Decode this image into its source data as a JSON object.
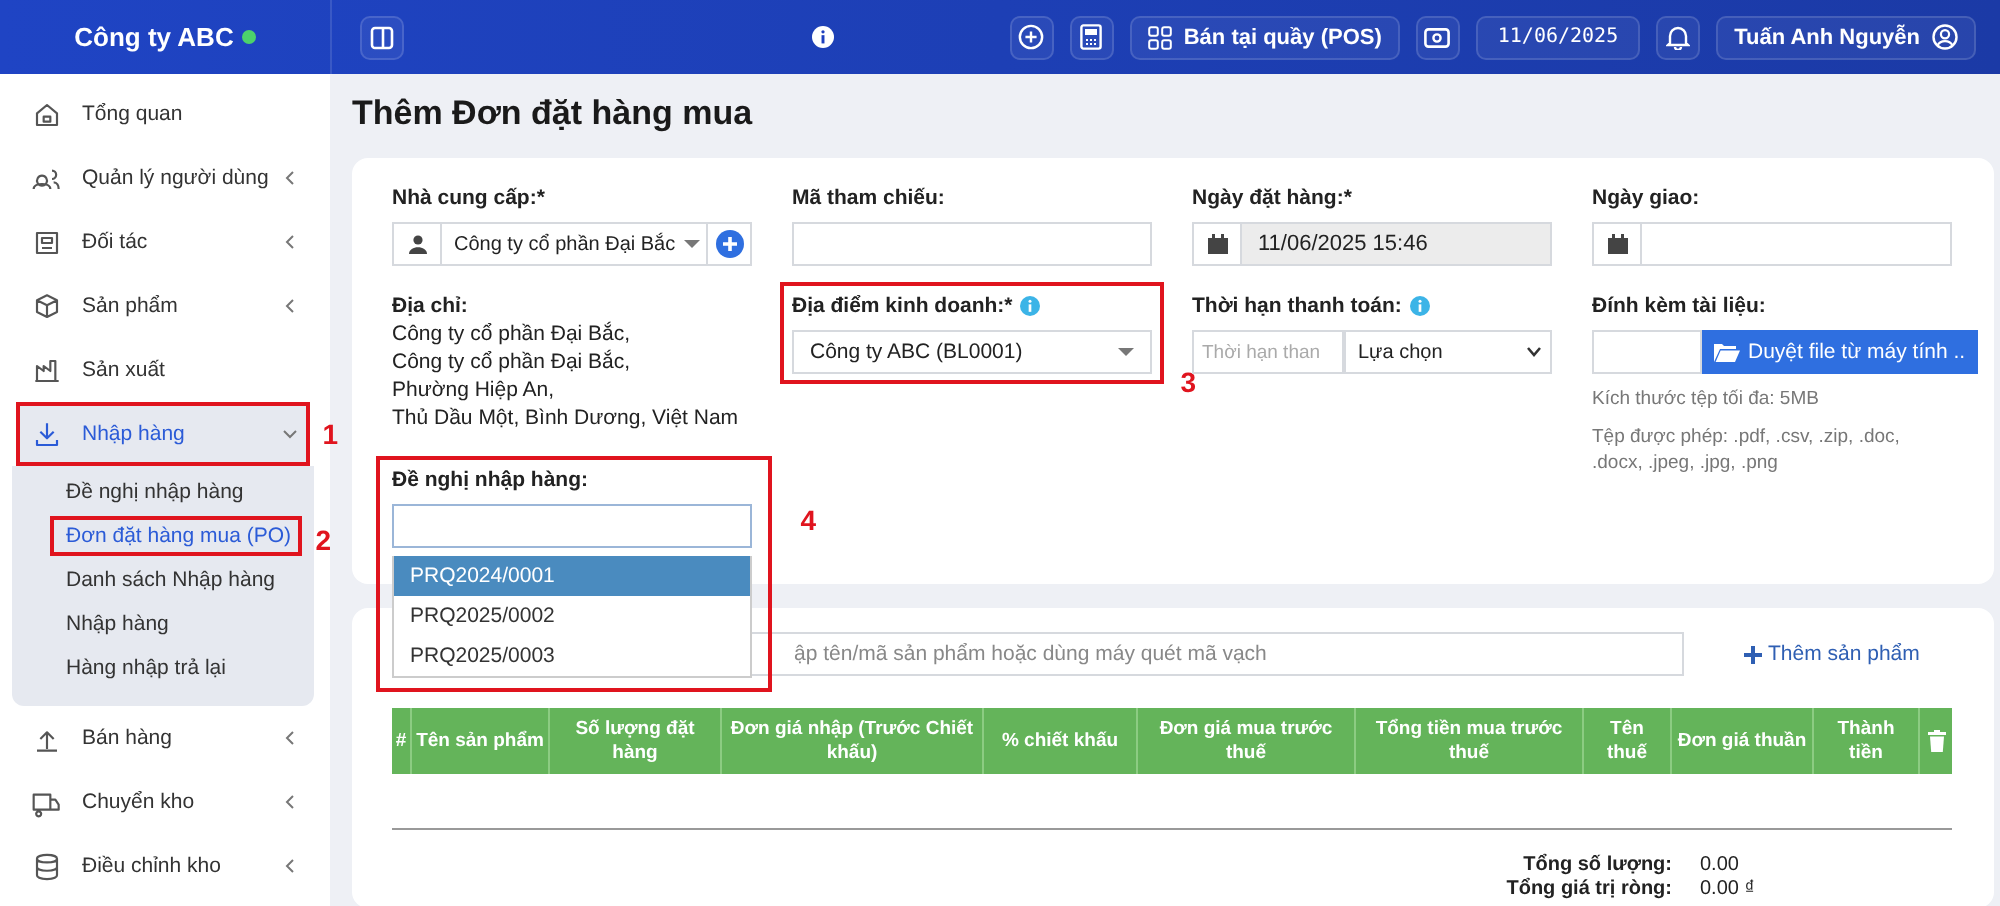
{
  "topbar": {
    "brand": "Công ty ABC",
    "pos_button": "Bán tại quầy (POS)",
    "date": "11/06/2025",
    "user": "Tuấn Anh Nguyễn"
  },
  "sidebar": {
    "items": [
      {
        "label": "Tổng quan",
        "selected": false
      },
      {
        "label": "Quản lý người dùng",
        "selected": false,
        "expanded": false
      },
      {
        "label": "Đối tác",
        "selected": false,
        "expanded": false
      },
      {
        "label": "Sản phẩm",
        "selected": false,
        "expanded": false
      },
      {
        "label": "Sản xuất",
        "selected": false
      },
      {
        "label": "Nhập hàng",
        "selected": true,
        "expanded": true,
        "annotation": "1",
        "children": [
          {
            "label": "Đề nghị nhập hàng",
            "selected": false
          },
          {
            "label": "Đơn đặt hàng mua (PO)",
            "selected": true,
            "annotation": "2"
          },
          {
            "label": "Danh sách Nhập hàng",
            "selected": false
          },
          {
            "label": "Nhập hàng",
            "selected": false
          },
          {
            "label": "Hàng nhập trả lại",
            "selected": false
          }
        ]
      },
      {
        "label": "Bán hàng",
        "selected": false,
        "expanded": false
      },
      {
        "label": "Chuyển kho",
        "selected": false,
        "expanded": false
      },
      {
        "label": "Điều chỉnh kho",
        "selected": false,
        "expanded": false
      }
    ]
  },
  "page": {
    "title": "Thêm Đơn đặt hàng mua"
  },
  "form": {
    "supplier": {
      "label": "Nhà cung cấp:*",
      "value": "Công ty cổ phần Đại Bắc"
    },
    "address": {
      "label": "Địa chỉ:",
      "lines": [
        "Công ty cổ phần Đại Bắc,",
        "Công ty cổ phần Đại Bắc,",
        "Phường Hiệp An,",
        "Thủ Dầu Một, Bình Dương, Việt Nam"
      ]
    },
    "proposal": {
      "label": "Đề nghị nhập hàng:",
      "annotation": "4",
      "options": [
        {
          "label": "PRQ2024/0001",
          "selected": true
        },
        {
          "label": "PRQ2025/0002",
          "selected": false
        },
        {
          "label": "PRQ2025/0003",
          "selected": false
        }
      ]
    },
    "reference": {
      "label": "Mã tham chiếu:"
    },
    "location": {
      "label": "Địa điểm kinh doanh:*",
      "value": "Công ty ABC (BL0001)",
      "annotation": "3"
    },
    "order_date": {
      "label": "Ngày đặt hàng:*",
      "value": "11/06/2025 15:46",
      "disabled": true
    },
    "payment_term": {
      "label": "Thời hạn thanh toán:",
      "placeholder": "Thời hạn than",
      "unit": "Lựa chọn"
    },
    "delivery_date": {
      "label": "Ngày giao:"
    },
    "attachment": {
      "label": "Đính kèm tài liệu:",
      "button": "Duyệt file từ máy tính ..",
      "hints": [
        "Kích thước tệp tối đa: 5MB",
        "Tệp được phép: .pdf, .csv, .zip, .doc, .docx, .jpeg, .jpg, .png"
      ]
    }
  },
  "products": {
    "search": {
      "placeholder": "ập tên/mã sản phẩm hoặc dùng máy quét mã vạch"
    },
    "add_link": "Thêm sản phẩm",
    "table": {
      "columns": [
        "#",
        "Tên sản phẩm",
        "Số lượng đặt hàng",
        "Đơn giá nhập (Trước Chiết khấu)",
        "% chiết khấu",
        "Đơn giá mua trước thuế",
        "Tổng tiền mua trước thuế",
        "Tên thuế",
        "Đơn giá thuần",
        "Thành tiền"
      ]
    },
    "totals": [
      {
        "label": "Tổng số lượng:",
        "value": "0.00"
      },
      {
        "label": "Tổng giá trị ròng:",
        "value": "0.00 ₫"
      }
    ]
  }
}
